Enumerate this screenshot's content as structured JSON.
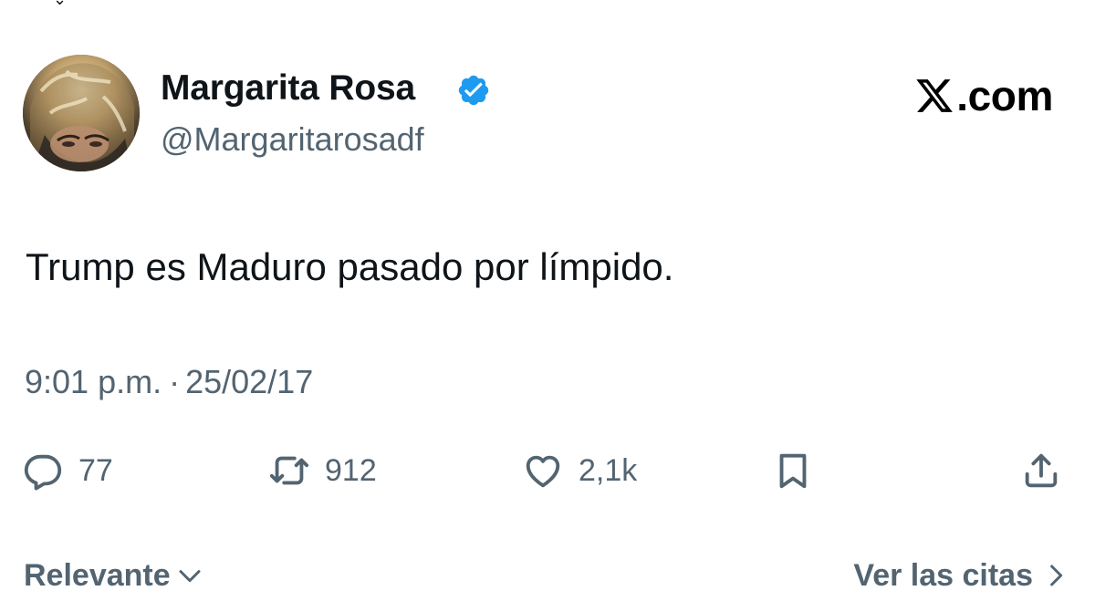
{
  "author": {
    "display_name": "Margarita Rosa",
    "handle": "@Margaritarosadf",
    "verified": true,
    "verified_color": "#1d9bf0"
  },
  "brand": {
    "text": ".com",
    "logo_icon": "x-logo-icon"
  },
  "tweet": {
    "text": "Trump es Maduro pasado por límpido.",
    "time": "9:01 p.m.",
    "separator": "·",
    "date": "25/02/17"
  },
  "actions": {
    "reply": {
      "icon": "reply-icon",
      "count": "77"
    },
    "retweet": {
      "icon": "retweet-icon",
      "count": "912"
    },
    "like": {
      "icon": "heart-icon",
      "count": "2,1k"
    },
    "bookmark": {
      "icon": "bookmark-icon"
    },
    "share": {
      "icon": "share-icon"
    }
  },
  "footer": {
    "sort_label": "Relevante",
    "quotes_label": "Ver las citas"
  },
  "colors": {
    "text_primary": "#0f1419",
    "text_secondary": "#536471",
    "accent": "#1d9bf0"
  }
}
